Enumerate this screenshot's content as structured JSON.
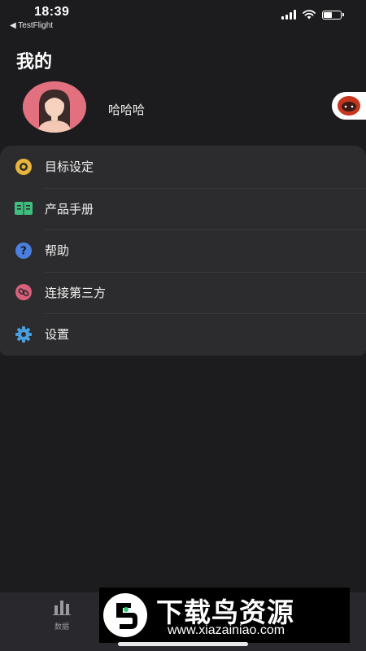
{
  "status_bar": {
    "time": "18:39",
    "back_label": "◀ TestFlight"
  },
  "page": {
    "title": "我的"
  },
  "profile": {
    "username": "哈哈哈"
  },
  "menu": {
    "items": [
      {
        "label": "目标设定",
        "icon": "target-icon",
        "color": "#e5b53c"
      },
      {
        "label": "产品手册",
        "icon": "book-icon",
        "color": "#3fbf7f"
      },
      {
        "label": "帮助",
        "icon": "help-icon",
        "color": "#4a7fe0"
      },
      {
        "label": "连接第三方",
        "icon": "link-icon",
        "color": "#d9607a"
      },
      {
        "label": "设置",
        "icon": "gear-icon",
        "color": "#4a9fe0"
      }
    ]
  },
  "tabbar": {
    "tabs": [
      {
        "label": "数据",
        "icon": "bar-chart-icon"
      }
    ]
  },
  "watermark": {
    "title": "下载鸟资源",
    "url": "www.xiazainiao.com"
  }
}
